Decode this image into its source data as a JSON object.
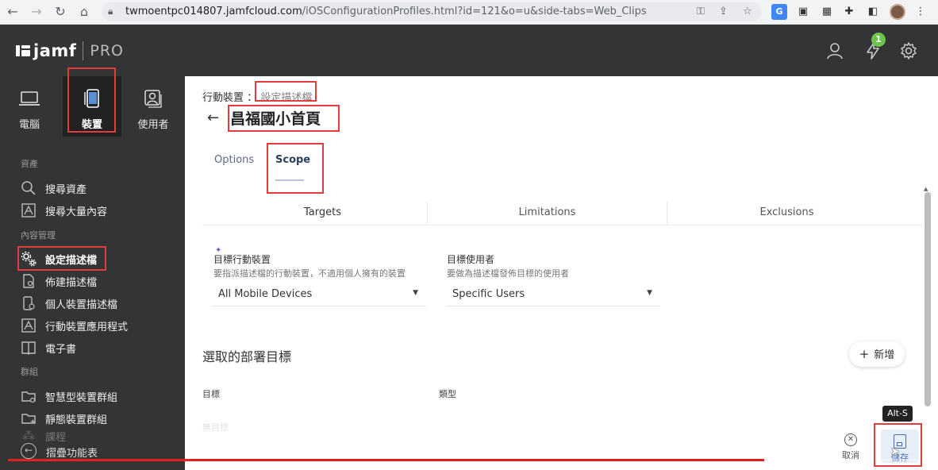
{
  "browser": {
    "url_host": "twmoentpc014807.jamfcloud.com",
    "url_path": "/iOSConfigurationProfiles.html?id=121&o=u&side-tabs=Web_Clips"
  },
  "brand": {
    "name": "jamf",
    "product": "PRO"
  },
  "notifications": {
    "count": "1"
  },
  "sidebar": {
    "tabs": [
      {
        "label": "電腦",
        "icon": "laptop-icon"
      },
      {
        "label": "裝置",
        "icon": "mobile-device-icon"
      },
      {
        "label": "使用者",
        "icon": "user-card-icon"
      }
    ],
    "sections": {
      "inventory": "資產",
      "content": "內容管理",
      "groups": "群組"
    },
    "items": [
      {
        "label": "搜尋資產",
        "icon": "search-icon"
      },
      {
        "label": "搜尋大量內容",
        "icon": "mass-search-icon"
      },
      {
        "label": "設定描述檔",
        "icon": "gear-cluster-icon"
      },
      {
        "label": "佈建描述檔",
        "icon": "provisioning-doc-icon"
      },
      {
        "label": "個人裝置描述檔",
        "icon": "personal-device-icon"
      },
      {
        "label": "行動裝置應用程式",
        "icon": "app-store-icon"
      },
      {
        "label": "電子書",
        "icon": "book-icon"
      },
      {
        "label": "智慧型裝置群組",
        "icon": "smart-folder-icon"
      },
      {
        "label": "靜態裝置群組",
        "icon": "static-folder-icon"
      },
      {
        "label": "課程",
        "icon": "classes-icon"
      }
    ],
    "collapse_label": "摺疊功能表"
  },
  "breadcrumb": {
    "parent": "行動裝置",
    "separator": "：",
    "current": "設定描述檔"
  },
  "page": {
    "title": "昌福國小首頁"
  },
  "tabs": {
    "options": "Options",
    "scope": "Scope"
  },
  "subtabs": {
    "targets": "Targets",
    "limitations": "Limitations",
    "exclusions": "Exclusions"
  },
  "scope": {
    "target_devices": {
      "label": "目標行動裝置",
      "help": "要指派描述檔的行動裝置，不適用個人擁有的裝置",
      "value": "All Mobile Devices"
    },
    "target_users": {
      "label": "目標使用者",
      "help": "要做為描述檔發佈目標的使用者",
      "value": "Specific Users"
    }
  },
  "deployment": {
    "title": "選取的部署目標",
    "add_label": "新增",
    "columns": {
      "target": "目標",
      "type": "類型"
    },
    "empty": "無目標"
  },
  "actions": {
    "cancel": "取消",
    "save": "儲存",
    "save_shortcut": "Alt-S"
  },
  "video": {
    "progress_fraction": 0.82
  }
}
